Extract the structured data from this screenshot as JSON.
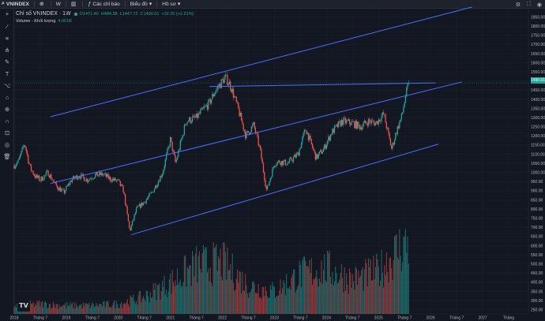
{
  "toolbar": {
    "symbol": "VNINDEX",
    "interval": "W",
    "indicators_label": "Các chỉ báo",
    "chart_type_label": "Biểu đồ",
    "profile_label": "Hồ sơ"
  },
  "legend": {
    "title": "Chỉ số VNINDEX · 1W",
    "open": "O1471.40",
    "high": "H484.38",
    "low": "L1447.72",
    "close": "C1490.01",
    "change": "+32.25 (+2.21%)",
    "volume_label": "Volume - Khối lượng",
    "volume_value": "4.001B"
  },
  "last_price": "1490.01",
  "colors": {
    "up": "#26a69a",
    "down": "#ef5350",
    "trendline": "#4c6fff",
    "background": "#131722"
  },
  "chart_data": {
    "type": "candlestick",
    "title": "Chỉ số VNINDEX · 1W",
    "y_axis": {
      "range": [
        227,
        1900
      ],
      "ticks": [
        "1850.00",
        "1800.00",
        "1750.00",
        "1700.00",
        "1650.00",
        "1600.00",
        "1550.00",
        "1500.00",
        "1450.00",
        "1400.00",
        "1350.00",
        "1300.00",
        "1250.00",
        "1200.00",
        "1150.00",
        "1100.00",
        "1050.00",
        "1000.00",
        "950.00",
        "900.00",
        "850.00",
        "800.00",
        "750.00",
        "700.00",
        "650.00",
        "600.00",
        "550.00",
        "500.00",
        "450.00",
        "400.00",
        "350.00",
        "300.00",
        "250.00"
      ]
    },
    "x_axis": {
      "range": [
        2018.0,
        2027.88
      ],
      "ticks": [
        {
          "label": "2018",
          "x": 2018.0
        },
        {
          "label": "Tháng 7",
          "x": 2018.5
        },
        {
          "label": "2019",
          "x": 2019.0
        },
        {
          "label": "Tháng 7",
          "x": 2019.5
        },
        {
          "label": "2020",
          "x": 2020.0
        },
        {
          "label": "Tháng 7",
          "x": 2020.5
        },
        {
          "label": "2021",
          "x": 2021.0
        },
        {
          "label": "Tháng 7",
          "x": 2021.5
        },
        {
          "label": "2022",
          "x": 2022.0
        },
        {
          "label": "Tháng 7",
          "x": 2022.5
        },
        {
          "label": "2023",
          "x": 2023.0
        },
        {
          "label": "Tháng 7",
          "x": 2023.5
        },
        {
          "label": "2024",
          "x": 2024.0
        },
        {
          "label": "Tháng 7",
          "x": 2024.5
        },
        {
          "label": "2025",
          "x": 2025.0
        },
        {
          "label": "Tháng 7",
          "x": 2025.5
        },
        {
          "label": "2026",
          "x": 2026.0
        },
        {
          "label": "Tháng 7",
          "x": 2026.5
        },
        {
          "label": "2027",
          "x": 2027.0
        },
        {
          "label": "Tháng",
          "x": 2027.5
        }
      ]
    },
    "price_path": [
      [
        2018.0,
        1040
      ],
      [
        2018.08,
        1060
      ],
      [
        2018.2,
        1160
      ],
      [
        2018.3,
        1030
      ],
      [
        2018.4,
        980
      ],
      [
        2018.5,
        960
      ],
      [
        2018.65,
        1000
      ],
      [
        2018.8,
        930
      ],
      [
        2018.95,
        890
      ],
      [
        2019.1,
        960
      ],
      [
        2019.25,
        985
      ],
      [
        2019.4,
        960
      ],
      [
        2019.55,
        985
      ],
      [
        2019.7,
        990
      ],
      [
        2019.85,
        965
      ],
      [
        2020.0,
        950
      ],
      [
        2020.1,
        900
      ],
      [
        2020.22,
        680
      ],
      [
        2020.35,
        800
      ],
      [
        2020.5,
        840
      ],
      [
        2020.65,
        890
      ],
      [
        2020.85,
        1000
      ],
      [
        2021.0,
        1180
      ],
      [
        2021.1,
        1050
      ],
      [
        2021.3,
        1280
      ],
      [
        2021.5,
        1300
      ],
      [
        2021.62,
        1340
      ],
      [
        2021.75,
        1380
      ],
      [
        2021.85,
        1440
      ],
      [
        2021.95,
        1480
      ],
      [
        2022.05,
        1520
      ],
      [
        2022.15,
        1480
      ],
      [
        2022.3,
        1350
      ],
      [
        2022.45,
        1200
      ],
      [
        2022.6,
        1260
      ],
      [
        2022.72,
        1130
      ],
      [
        2022.85,
        900
      ],
      [
        2023.0,
        1050
      ],
      [
        2023.1,
        1060
      ],
      [
        2023.25,
        1050
      ],
      [
        2023.45,
        1100
      ],
      [
        2023.6,
        1240
      ],
      [
        2023.8,
        1080
      ],
      [
        2023.95,
        1130
      ],
      [
        2024.1,
        1220
      ],
      [
        2024.3,
        1280
      ],
      [
        2024.5,
        1270
      ],
      [
        2024.65,
        1250
      ],
      [
        2024.8,
        1280
      ],
      [
        2024.95,
        1270
      ],
      [
        2025.1,
        1320
      ],
      [
        2025.25,
        1130
      ],
      [
        2025.35,
        1230
      ],
      [
        2025.45,
        1310
      ],
      [
        2025.52,
        1420
      ],
      [
        2025.58,
        1490
      ]
    ],
    "trendlines": [
      {
        "from": [
          2018.7,
          1305
        ],
        "to": [
          2026.8,
          1905
        ]
      },
      {
        "from": [
          2021.75,
          1470
        ],
        "to": [
          2026.1,
          1490
        ]
      },
      {
        "from": [
          2018.7,
          940
        ],
        "to": [
          2026.6,
          1495
        ]
      },
      {
        "from": [
          2020.25,
          660
        ],
        "to": [
          2026.15,
          1155
        ]
      }
    ],
    "volume": [
      [
        2018.0,
        30
      ],
      [
        2018.5,
        35
      ],
      [
        2019.0,
        30
      ],
      [
        2019.5,
        30
      ],
      [
        2020.0,
        35
      ],
      [
        2020.5,
        60
      ],
      [
        2021.0,
        110
      ],
      [
        2021.5,
        170
      ],
      [
        2022.0,
        180
      ],
      [
        2022.5,
        100
      ],
      [
        2023.0,
        80
      ],
      [
        2023.5,
        140
      ],
      [
        2024.0,
        160
      ],
      [
        2024.5,
        120
      ],
      [
        2025.0,
        150
      ],
      [
        2025.45,
        240
      ],
      [
        2025.55,
        250
      ]
    ]
  }
}
